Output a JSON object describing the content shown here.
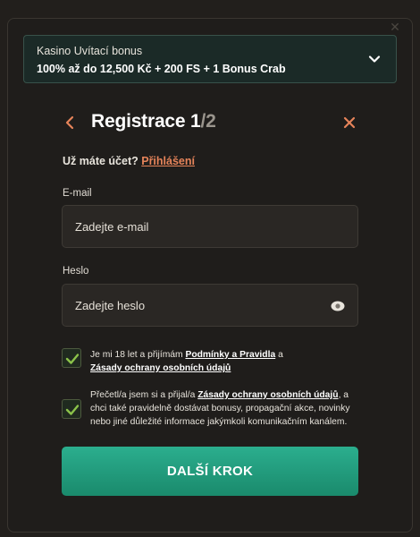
{
  "bonus": {
    "title": "Kasino Uvítací bonus",
    "description": "100% až do 12,500 Kč + 200 FS + 1 Bonus Crab"
  },
  "header": {
    "title": "Registrace",
    "step_current": "1",
    "step_total": "/2"
  },
  "login": {
    "prompt": "Už máte účet?",
    "link": "Přihlášení"
  },
  "email": {
    "label": "E-mail",
    "placeholder": "Zadejte e-mail"
  },
  "password": {
    "label": "Heslo",
    "placeholder": "Zadejte heslo"
  },
  "terms": {
    "prefix": "Je mi 18 let a přijímám",
    "link1": "Podmínky a Pravidla",
    "middle": "a",
    "link2": "Zásady ochrany osobních údajů",
    "checked": true
  },
  "marketing": {
    "prefix": "Přečetl/a jsem si a přijal/a",
    "link": "Zásady ochrany osobních údajů",
    "suffix": ", a chci také pravidelně dostávat bonusy, propagační akce, novinky nebo jiné důležité informace jakýmkoli komunikačním kanálem.",
    "checked": true
  },
  "submit": {
    "label": "DALŠÍ KROK"
  },
  "colors": {
    "accent": "#e6845a",
    "button": "#22a07f",
    "check": "#8bc34a"
  }
}
